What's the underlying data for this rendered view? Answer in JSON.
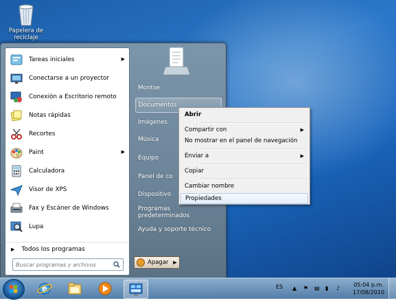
{
  "desktop": {
    "icons": [
      {
        "label": "Papelera de reciclaje",
        "icon": "recycle-bin-icon"
      }
    ]
  },
  "start_menu": {
    "programs": [
      {
        "label": "Tareas iniciales",
        "icon": "getting-started-icon",
        "has_submenu": true
      },
      {
        "label": "Conectarse a un proyector",
        "icon": "projector-icon",
        "has_submenu": false
      },
      {
        "label": "Conexión a Escritorio remoto",
        "icon": "remote-desktop-icon",
        "has_submenu": false
      },
      {
        "label": "Notas rápidas",
        "icon": "sticky-notes-icon",
        "has_submenu": false
      },
      {
        "label": "Recortes",
        "icon": "snipping-tool-icon",
        "has_submenu": false
      },
      {
        "label": "Paint",
        "icon": "paint-icon",
        "has_submenu": true
      },
      {
        "label": "Calculadora",
        "icon": "calculator-icon",
        "has_submenu": false
      },
      {
        "label": "Visor de XPS",
        "icon": "xps-viewer-icon",
        "has_submenu": false
      },
      {
        "label": "Fax y Escáner de Windows",
        "icon": "fax-scanner-icon",
        "has_submenu": false
      },
      {
        "label": "Lupa",
        "icon": "magnifier-icon",
        "has_submenu": false
      }
    ],
    "all_programs": "Todos los programas",
    "search_placeholder": "Buscar programas y archivos",
    "right_items": [
      "Montse",
      "Documentos",
      "Imágenes",
      "Música",
      "Equipo",
      "Panel de co",
      "Dispositivo",
      "Programas predeterminados",
      "Ayuda y soporte técnico"
    ],
    "highlighted_right_item": "Documentos",
    "shutdown_label": "Apagar"
  },
  "context_menu": {
    "items": [
      {
        "label": "Abrir",
        "bold": true,
        "has_submenu": false
      },
      {
        "label": "Compartir con",
        "bold": false,
        "has_submenu": true
      },
      {
        "label": "No mostrar en el panel de navegación",
        "bold": false,
        "has_submenu": false
      },
      {
        "label": "Enviar a",
        "bold": false,
        "has_submenu": true
      },
      {
        "label": "Copiar",
        "bold": false,
        "has_submenu": false
      },
      {
        "label": "Cambiar nombre",
        "bold": false,
        "has_submenu": false
      },
      {
        "label": "Propiedades",
        "bold": false,
        "has_submenu": false,
        "highlighted": true
      }
    ]
  },
  "taskbar": {
    "pinned": [
      {
        "icon": "internet-explorer-icon"
      },
      {
        "icon": "windows-explorer-icon"
      },
      {
        "icon": "media-player-icon"
      },
      {
        "icon": "control-panel-icon",
        "active": true
      }
    ],
    "language": "ES",
    "time": "05:04 p.m.",
    "date": "17/08/2010"
  }
}
